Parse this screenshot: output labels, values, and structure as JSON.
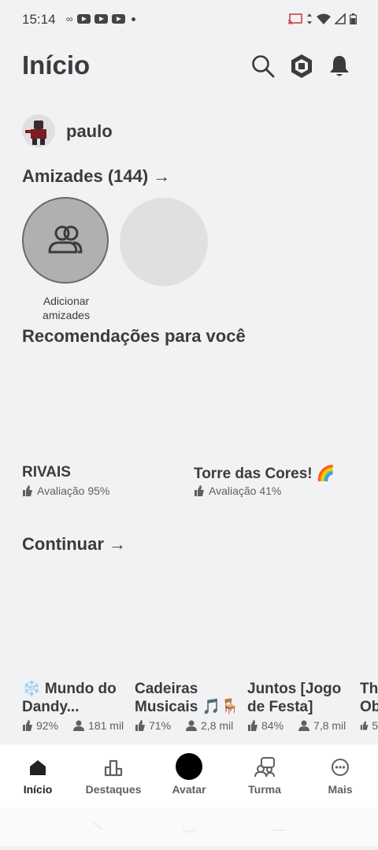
{
  "status_bar": {
    "time": "15:14",
    "icons": [
      "assistant-icon",
      "youtube-icon",
      "youtube-icon",
      "youtube-icon",
      "dot-icon",
      "cast-icon",
      "data-arrows-icon",
      "wifi-icon",
      "signal-icon",
      "battery-icon"
    ]
  },
  "header": {
    "title": "Início",
    "icons": [
      "search-icon",
      "robux-icon",
      "bell-icon"
    ]
  },
  "profile": {
    "name": "paulo"
  },
  "friends": {
    "title": "Amizades (144) →",
    "add_label": "Adicionar amizades"
  },
  "recommendations": {
    "title": "Recomendações para você",
    "games": [
      {
        "name": "RIVAIS",
        "rating": "Avaliação 95%"
      },
      {
        "name": "Torre das Cores! 🌈",
        "rating": "Avaliação 41%"
      }
    ]
  },
  "continue": {
    "title": "Continuar →",
    "games": [
      {
        "line1": "❄️ Mundo do",
        "line2": "Dandy...",
        "rating": "92%",
        "players": "181 mil"
      },
      {
        "line1": "Cadeiras",
        "line2": "Musicais 🎵🪑",
        "rating": "71%",
        "players": "2,8 mil"
      },
      {
        "line1": "Juntos [Jogo",
        "line2": "de Festa]",
        "rating": "84%",
        "players": "7,8 mil"
      },
      {
        "line1": "Th",
        "line2": "Ob",
        "rating": "5",
        "players": ""
      }
    ]
  },
  "bottom_nav": {
    "items": [
      {
        "label": "Início",
        "icon": "home-icon"
      },
      {
        "label": "Destaques",
        "icon": "charts-icon"
      },
      {
        "label": "Avatar",
        "icon": "avatar-icon"
      },
      {
        "label": "Turma",
        "icon": "party-icon"
      },
      {
        "label": "Mais",
        "icon": "more-icon"
      }
    ]
  }
}
